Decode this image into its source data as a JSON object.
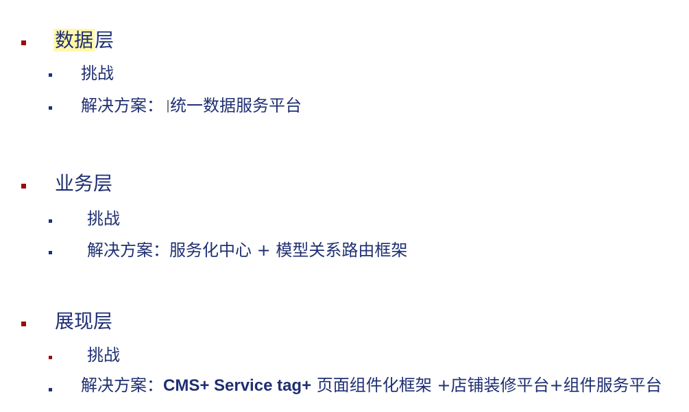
{
  "sections": [
    {
      "title_highlight": "数据",
      "title_rest": "层",
      "challenge": "挑战",
      "solution_prefix": "解决方案：",
      "solution_text": "统一数据服务平台"
    },
    {
      "title": "业务层",
      "challenge": "挑战",
      "solution_prefix": "解决方案：",
      "solution_text": "服务化中心 + 模型关系路由框架"
    },
    {
      "title": "展现层",
      "challenge": "挑战",
      "solution_prefix": "解决方案：",
      "solution_bold": "CMS+ Service tag+",
      "solution_text": " 页面组件化框架 +店铺装修平台+组件服务平台"
    }
  ],
  "colors": {
    "text": "#1f2f73",
    "bullet_level1": "#9b0b0b",
    "bullet_level2": "#1f2f7a",
    "highlight": "#fff8a8"
  }
}
